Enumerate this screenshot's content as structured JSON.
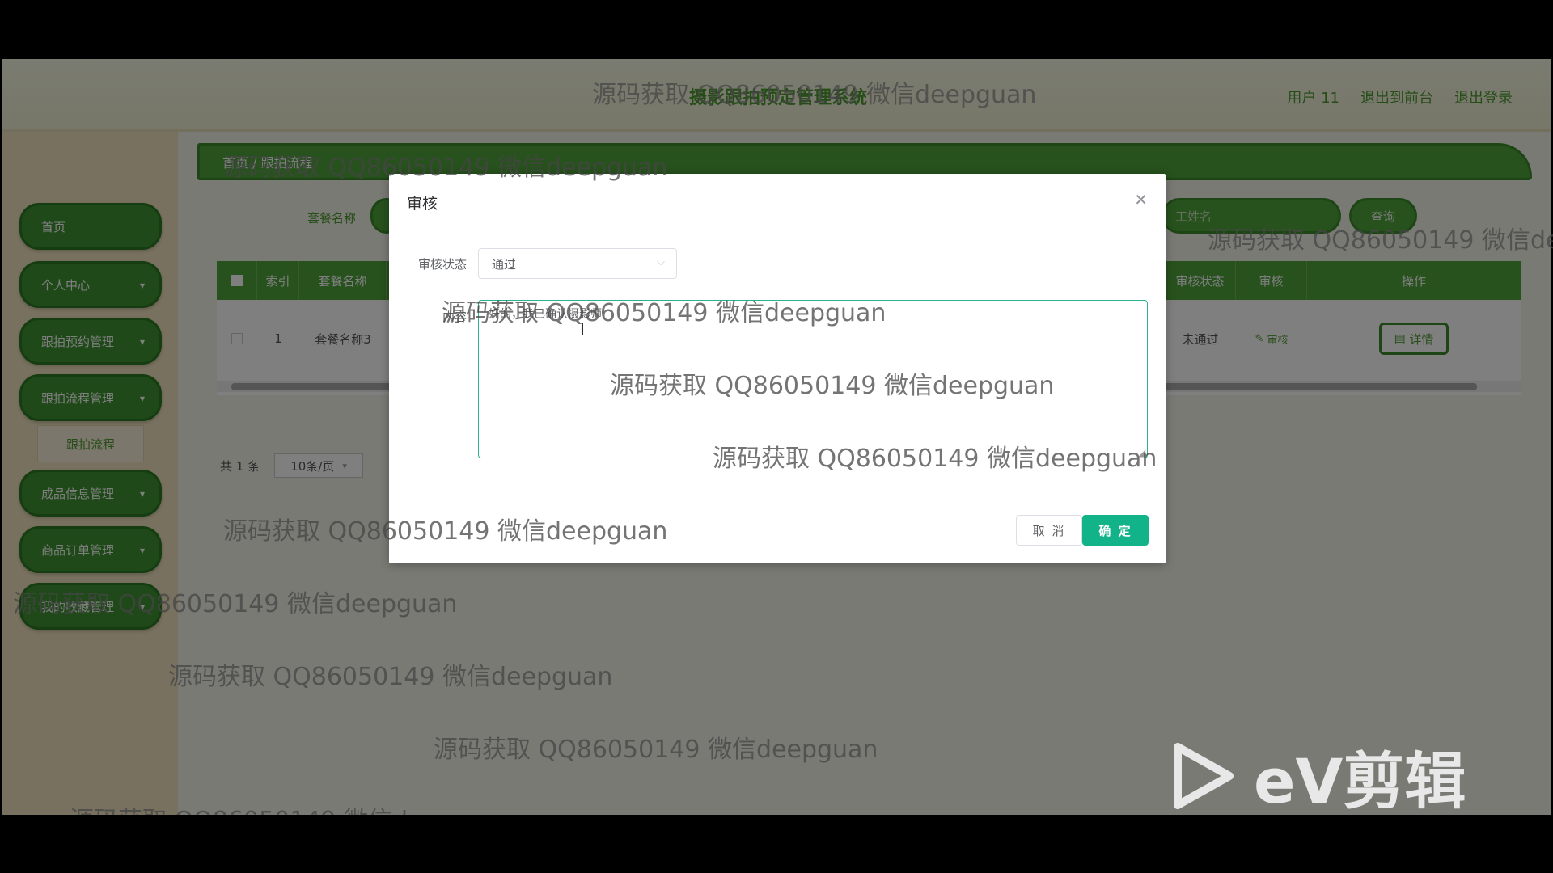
{
  "header": {
    "title": "摄影跟拍预定管理系统",
    "links": [
      "用户 11",
      "退出到前台",
      "退出登录"
    ]
  },
  "sidebar": {
    "items": [
      {
        "label": "首页"
      },
      {
        "label": "个人中心"
      },
      {
        "label": "跟拍预约管理"
      },
      {
        "label": "跟拍流程管理"
      },
      {
        "label": "成品信息管理"
      },
      {
        "label": "商品订单管理"
      },
      {
        "label": "我的收藏管理"
      }
    ],
    "submenu": "跟拍流程"
  },
  "content": {
    "breadcrumb": "首页 / 跟拍流程",
    "search_label": "套餐名称",
    "search_right": "工姓名",
    "search_button": "查询",
    "table": {
      "headers": [
        "",
        "索引",
        "套餐名称",
        "审核状态",
        "审核",
        "操作"
      ],
      "row": {
        "index": "1",
        "name": "套餐名称3",
        "status": "未通过",
        "audit": "审核",
        "detail": "详情"
      }
    },
    "pager": {
      "total": "共 1 条",
      "size": "10条/页"
    }
  },
  "dialog": {
    "title": "审核",
    "status_label": "审核状态",
    "status_value": "通过",
    "content_label": "内容",
    "content_value": "好的，我已确认摄影师",
    "cancel": "取 消",
    "confirm": "确 定"
  },
  "watermark": "源码获取 QQ86050149 微信deepguan",
  "logo": {
    "text": "eV剪辑"
  }
}
